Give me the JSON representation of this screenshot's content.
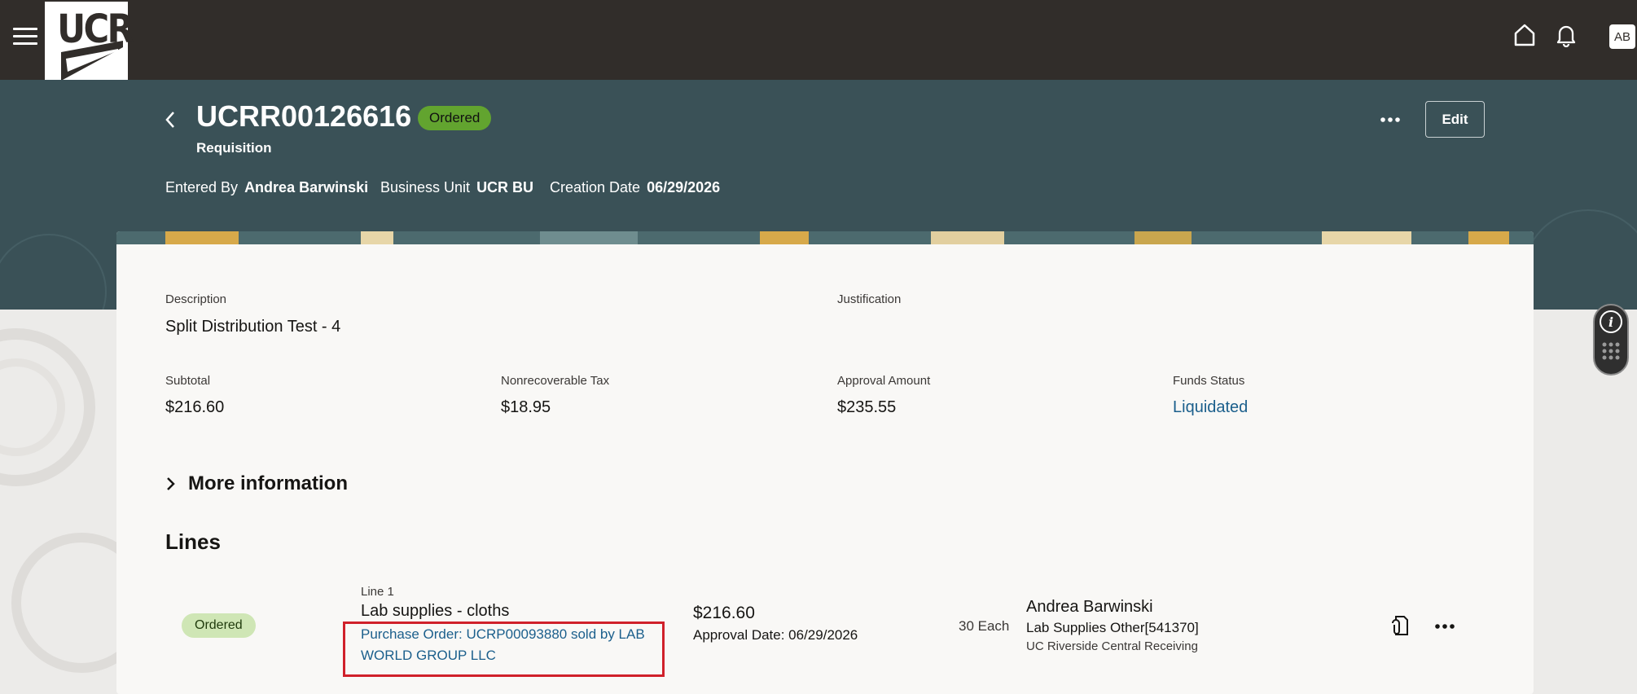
{
  "topbar": {
    "logo_text": "UCR",
    "avatar_initials": "AB",
    "icons": [
      "menu-icon",
      "home-icon",
      "bell-icon"
    ]
  },
  "header": {
    "requisition_number": "UCRR00126616",
    "status": "Ordered",
    "subtitle": "Requisition",
    "entered_by_label": "Entered By",
    "entered_by_value": "Andrea Barwinski",
    "business_unit_label": "Business Unit",
    "business_unit_value": "UCR BU",
    "creation_date_label": "Creation Date",
    "creation_date_value": "06/29/2026",
    "edit_label": "Edit"
  },
  "summary": {
    "description_label": "Description",
    "description_value": "Split Distribution Test - 4",
    "justification_label": "Justification",
    "subtotal_label": "Subtotal",
    "subtotal_value": "$216.60",
    "tax_label": "Nonrecoverable Tax",
    "tax_value": "$18.95",
    "approval_amount_label": "Approval Amount",
    "approval_amount_value": "$235.55",
    "funds_status_label": "Funds Status",
    "funds_status_value": "Liquidated",
    "more_information_label": "More information"
  },
  "lines": {
    "title": "Lines",
    "items": [
      {
        "status": "Ordered",
        "line_number": "Line 1",
        "name": "Lab supplies - cloths",
        "po_link": "Purchase Order: UCRP00093880 sold by LAB WORLD GROUP LLC",
        "amount": "$216.60",
        "approval_date": "Approval Date: 06/29/2026",
        "quantity": "30 Each",
        "requester": "Andrea Barwinski",
        "category": "Lab Supplies Other[541370]",
        "location": "UC Riverside Central Receiving"
      }
    ]
  },
  "colors": {
    "topbar": "#312d2a",
    "header_band": "#3a5157",
    "status_green": "#62a42f",
    "link_blue": "#1b5f8c",
    "highlight_red": "#d0202a"
  }
}
